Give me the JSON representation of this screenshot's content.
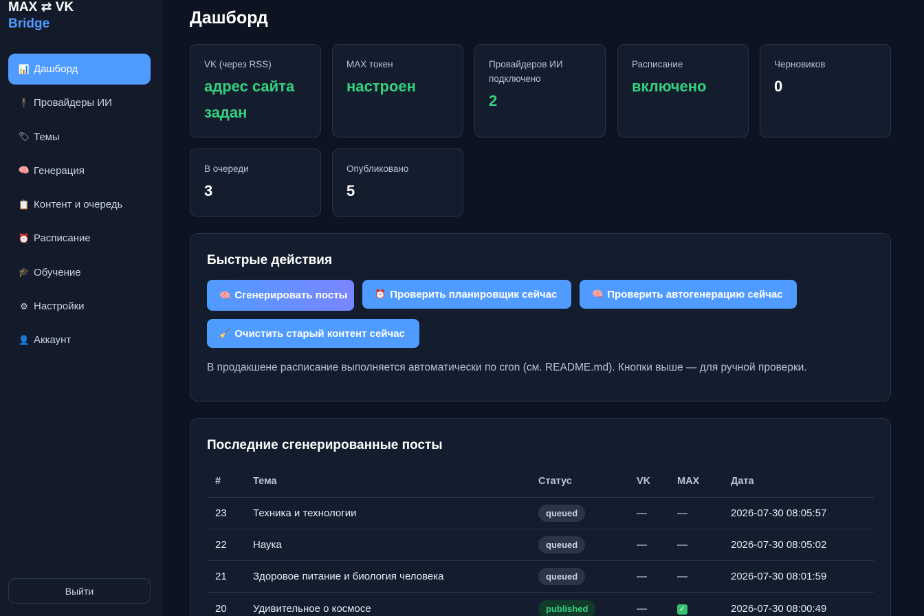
{
  "brand": {
    "line1": "MAX ⇄ VK",
    "line2": "Bridge"
  },
  "sidebar": {
    "items": [
      {
        "icon": "📊",
        "label": "Дашборд"
      },
      {
        "icon": "🕴",
        "label": "Провайдеры ИИ"
      },
      {
        "icon": "🏷",
        "label": "Темы"
      },
      {
        "icon": "🧠",
        "label": "Генерация"
      },
      {
        "icon": "📋",
        "label": "Контент и очередь"
      },
      {
        "icon": "⏰",
        "label": "Расписание"
      },
      {
        "icon": "🎓",
        "label": "Обучение"
      },
      {
        "icon": "⚙",
        "label": "Настройки"
      },
      {
        "icon": "👤",
        "label": "Аккаунт"
      }
    ],
    "logout_label": "Выйти"
  },
  "page": {
    "title": "Дашборд"
  },
  "stats": [
    {
      "label": "VK (через RSS)",
      "value": "адрес сайта задан"
    },
    {
      "label": "MAX токен",
      "value": "настроен"
    },
    {
      "label": "Провайдеров ИИ подключено",
      "value": "2"
    },
    {
      "label": "Расписание",
      "value": "включено"
    },
    {
      "label": "Черновиков",
      "value": "0"
    },
    {
      "label": "В очереди",
      "value": "3"
    },
    {
      "label": "Опубликовано",
      "value": "5"
    }
  ],
  "quick": {
    "title": "Быстрые действия",
    "buttons": [
      {
        "icon": "🧠",
        "label": "Сгенерировать посты"
      },
      {
        "icon": "⏰",
        "label": "Проверить планировщик сейчас"
      },
      {
        "icon": "🧠",
        "label": "Проверить автогенерацию сейчас"
      },
      {
        "icon": "🧹",
        "label": "Очистить старый контент сейчас"
      }
    ],
    "hint": "В продакшене расписание выполняется автоматически по cron (см. README.md). Кнопки выше — для ручной проверки."
  },
  "recent": {
    "title": "Последние сгенерированные посты",
    "headers": [
      "#",
      "Тема",
      "Статус",
      "VK",
      "MAX",
      "Дата"
    ],
    "rows": [
      {
        "num": "23",
        "topic": "Техника и технологии",
        "status": "queued",
        "vk": "—",
        "max": "—",
        "date": "2026-07-30 08:05:57"
      },
      {
        "num": "22",
        "topic": "Наука",
        "status": "queued",
        "vk": "—",
        "max": "—",
        "date": "2026-07-30 08:05:02"
      },
      {
        "num": "21",
        "topic": "Здоровое питание и биология человека",
        "status": "queued",
        "vk": "—",
        "max": "—",
        "date": "2026-07-30 08:01:59"
      },
      {
        "num": "20",
        "topic": "Удивительное о космосе",
        "status": "published",
        "vk": "—",
        "max": "✓",
        "date": "2026-07-30 08:00:49"
      }
    ]
  },
  "colors": {
    "accent": "#4f9bff",
    "success": "#34d17f",
    "background": "#0d1320",
    "card": "#141d2e"
  }
}
